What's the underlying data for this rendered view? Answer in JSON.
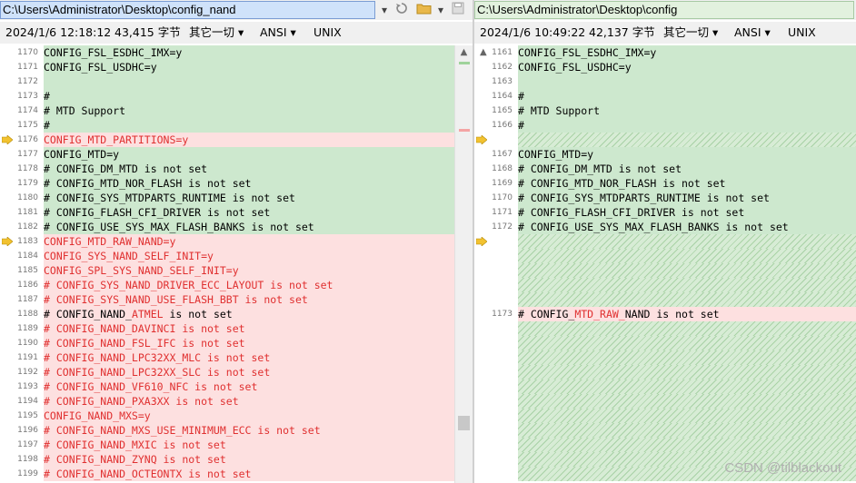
{
  "left": {
    "path": "C:\\Users\\Administrator\\Desktop\\config_nand",
    "date": "2024/1/6 12:18:12",
    "size": "43,415 字节",
    "filter": "其它一切",
    "encoding": "ANSI",
    "eol": "UNIX",
    "lines": [
      {
        "n": "1170",
        "t": "CONFIG_FSL_ESDHC_IMX=y",
        "c": "g"
      },
      {
        "n": "1171",
        "t": "CONFIG_FSL_USDHC=y",
        "c": "g"
      },
      {
        "n": "1172",
        "t": "",
        "c": "g"
      },
      {
        "n": "1173",
        "t": "#",
        "c": "g"
      },
      {
        "n": "1174",
        "t": "# MTD Support",
        "c": "g"
      },
      {
        "n": "1175",
        "t": "#",
        "c": "g"
      },
      {
        "n": "1176",
        "t": "CONFIG_MTD_PARTITIONS=y",
        "c": "r",
        "arrow": true
      },
      {
        "n": "1177",
        "t": "CONFIG_MTD=y",
        "c": "g"
      },
      {
        "n": "1178",
        "t": "# CONFIG_DM_MTD is not set",
        "c": "g"
      },
      {
        "n": "1179",
        "t": "# CONFIG_MTD_NOR_FLASH is not set",
        "c": "g"
      },
      {
        "n": "1180",
        "t": "# CONFIG_SYS_MTDPARTS_RUNTIME is not set",
        "c": "g"
      },
      {
        "n": "1181",
        "t": "# CONFIG_FLASH_CFI_DRIVER is not set",
        "c": "g"
      },
      {
        "n": "1182",
        "t": "# CONFIG_USE_SYS_MAX_FLASH_BANKS is not set",
        "c": "g"
      },
      {
        "n": "1183",
        "t": "CONFIG_MTD_RAW_NAND=y",
        "c": "r",
        "arrow": true
      },
      {
        "n": "1184",
        "t": "CONFIG_SYS_NAND_SELF_INIT=y",
        "c": "r"
      },
      {
        "n": "1185",
        "t": "CONFIG_SPL_SYS_NAND_SELF_INIT=y",
        "c": "r"
      },
      {
        "n": "1186",
        "t": "# CONFIG_SYS_NAND_DRIVER_ECC_LAYOUT is not set",
        "c": "r"
      },
      {
        "n": "1187",
        "t": "# CONFIG_SYS_NAND_USE_FLASH_BBT is not set",
        "c": "r"
      },
      {
        "n": "1188",
        "t": "# CONFIG_NAND_ATMEL is not set",
        "c": "r",
        "mix": true
      },
      {
        "n": "1189",
        "t": "# CONFIG_NAND_DAVINCI is not set",
        "c": "r"
      },
      {
        "n": "1190",
        "t": "# CONFIG_NAND_FSL_IFC is not set",
        "c": "r"
      },
      {
        "n": "1191",
        "t": "# CONFIG_NAND_LPC32XX_MLC is not set",
        "c": "r"
      },
      {
        "n": "1192",
        "t": "# CONFIG_NAND_LPC32XX_SLC is not set",
        "c": "r"
      },
      {
        "n": "1193",
        "t": "# CONFIG_NAND_VF610_NFC is not set",
        "c": "r"
      },
      {
        "n": "1194",
        "t": "# CONFIG_NAND_PXA3XX is not set",
        "c": "r"
      },
      {
        "n": "1195",
        "t": "CONFIG_NAND_MXS=y",
        "c": "r"
      },
      {
        "n": "1196",
        "t": "# CONFIG_NAND_MXS_USE_MINIMUM_ECC is not set",
        "c": "r"
      },
      {
        "n": "1197",
        "t": "# CONFIG_NAND_MXIC is not set",
        "c": "r"
      },
      {
        "n": "1198",
        "t": "# CONFIG_NAND_ZYNQ is not set",
        "c": "r"
      },
      {
        "n": "1199",
        "t": "# CONFIG_NAND_OCTEONTX is not set",
        "c": "r"
      }
    ]
  },
  "right": {
    "path": "C:\\Users\\Administrator\\Desktop\\config",
    "date": "2024/1/6 10:49:22",
    "size": "42,137 字节",
    "filter": "其它一切",
    "encoding": "ANSI",
    "eol": "UNIX",
    "lines": [
      {
        "n": "1161",
        "t": "CONFIG_FSL_ESDHC_IMX=y",
        "c": "g"
      },
      {
        "n": "1162",
        "t": "CONFIG_FSL_USDHC=y",
        "c": "g"
      },
      {
        "n": "1163",
        "t": "",
        "c": "g"
      },
      {
        "n": "1164",
        "t": "#",
        "c": "g"
      },
      {
        "n": "1165",
        "t": "# MTD Support",
        "c": "g"
      },
      {
        "n": "1166",
        "t": "#",
        "c": "g"
      },
      {
        "n": "",
        "t": "",
        "c": "hatch",
        "arrow": true
      },
      {
        "n": "1167",
        "t": "CONFIG_MTD=y",
        "c": "g"
      },
      {
        "n": "1168",
        "t": "# CONFIG_DM_MTD is not set",
        "c": "g"
      },
      {
        "n": "1169",
        "t": "# CONFIG_MTD_NOR_FLASH is not set",
        "c": "g"
      },
      {
        "n": "1170",
        "t": "# CONFIG_SYS_MTDPARTS_RUNTIME is not set",
        "c": "g"
      },
      {
        "n": "1171",
        "t": "# CONFIG_FLASH_CFI_DRIVER is not set",
        "c": "g"
      },
      {
        "n": "1172",
        "t": "# CONFIG_USE_SYS_MAX_FLASH_BANKS is not set",
        "c": "g"
      },
      {
        "n": "",
        "t": "",
        "c": "hatch",
        "arrow": true
      },
      {
        "n": "",
        "t": "",
        "c": "hatch"
      },
      {
        "n": "",
        "t": "",
        "c": "hatch"
      },
      {
        "n": "",
        "t": "",
        "c": "hatch"
      },
      {
        "n": "",
        "t": "",
        "c": "hatch"
      },
      {
        "n": "1173",
        "t": "# CONFIG_MTD_RAW_NAND is not set",
        "c": "r",
        "mix2": true
      },
      {
        "n": "",
        "t": "",
        "c": "hatch"
      },
      {
        "n": "",
        "t": "",
        "c": "hatch"
      },
      {
        "n": "",
        "t": "",
        "c": "hatch"
      },
      {
        "n": "",
        "t": "",
        "c": "hatch"
      },
      {
        "n": "",
        "t": "",
        "c": "hatch"
      },
      {
        "n": "",
        "t": "",
        "c": "hatch"
      },
      {
        "n": "",
        "t": "",
        "c": "hatch"
      },
      {
        "n": "",
        "t": "",
        "c": "hatch"
      },
      {
        "n": "",
        "t": "",
        "c": "hatch"
      },
      {
        "n": "",
        "t": "",
        "c": "hatch"
      },
      {
        "n": "",
        "t": "",
        "c": "hatch"
      }
    ]
  },
  "watermark": "CSDN @tilblackout",
  "icons": {
    "refresh": "refresh-icon",
    "folder": "folder-icon",
    "save": "save-icon"
  }
}
